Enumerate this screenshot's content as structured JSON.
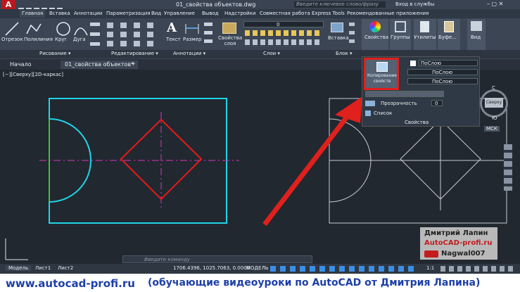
{
  "titlebar": {
    "filename": "01_свойства объектов.dwg",
    "search_placeholder": "Введите ключевое слово/фразу",
    "signin": "Вход в службы"
  },
  "menu": [
    "Главная",
    "Вставка",
    "Аннотации",
    "Параметризация",
    "Вид",
    "Управление",
    "Вывод",
    "Надстройки",
    "Совместная работа",
    "Express Tools",
    "Рекомендованные приложения"
  ],
  "ribbon": {
    "draw": {
      "tools": [
        "Отрезок",
        "Полилиния",
        "Круг",
        "Дуга"
      ],
      "panel": "Рисование ▾"
    },
    "modify": {
      "panel": "Редактирование ▾"
    },
    "annotation": {
      "tools": [
        "Текст",
        "Размер"
      ],
      "panel": "Аннотации ▾"
    },
    "layers": {
      "props_label": "Свойства слоя",
      "layer_value": "0",
      "panel": "Слои ▾"
    },
    "block": {
      "insert": "Вставка",
      "panel": "Блок ▾"
    },
    "right": [
      "Свойства",
      "Группы",
      "Утилиты",
      "Буфе...",
      "Вид"
    ]
  },
  "doctabs": {
    "start": "Начало",
    "active": "01_свойства объектов*",
    "plus": "+"
  },
  "viewport": {
    "label": "[−][Сверху][2D-каркас]",
    "viewcube": {
      "top": "С",
      "face": "Сверху",
      "bottom": "Ю",
      "wcs": "МСК"
    }
  },
  "props_popup": {
    "match_label": "Копирование свойств",
    "color": "ПоСлою",
    "linetype": "ПоСлою",
    "lineweight": "ПоСлою",
    "transparency_label": "Прозрачность",
    "transparency_value": "0",
    "list_label": "Список",
    "panel": "Свойства"
  },
  "command_placeholder": "Введите команду",
  "status": {
    "coords": "1706.4396, 1025.7063, 0.0000",
    "mode": "МОДЕЛЬ",
    "scale": "1:1"
  },
  "layout_tabs": [
    "Модель",
    "Лист1",
    "Лист2"
  ],
  "watermark": {
    "name": "Дмитрий Лапин",
    "site": "AutoCAD-profi.ru",
    "channel": "Nagwal007"
  },
  "footer": {
    "url": "www.autocad-profi.ru",
    "tagline": "(обучающие видеоуроки по AutoCAD от Дмитрия Лапина)"
  },
  "colors": {
    "accent_red": "#e0201c",
    "cyan": "#21d4e6",
    "magenta": "#d23ab8",
    "drawing_red": "#e81b1b",
    "footer_blue": "#1d3fa8"
  }
}
